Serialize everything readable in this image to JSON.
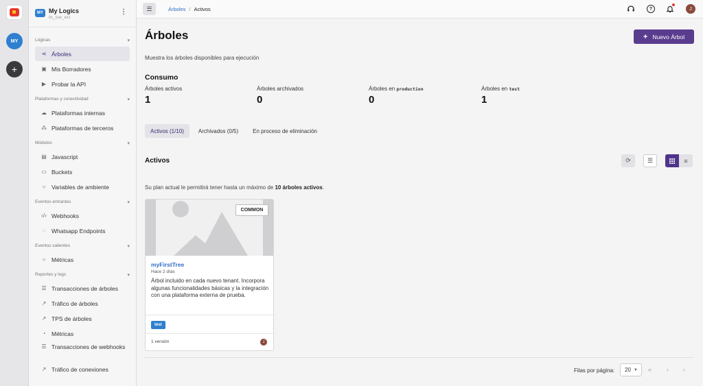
{
  "app": {
    "tenant_badge": "MY",
    "tenant_name": "My Logics",
    "tenant_id": "lts_soe_exz",
    "rail_avatar": "MY",
    "rail_add": "+"
  },
  "sidebar": {
    "sections": [
      {
        "label": "Lógicas",
        "items": [
          {
            "label": "Árboles",
            "icon": "share-icon",
            "active": true
          },
          {
            "label": "Mis Borradores",
            "icon": "image-icon"
          },
          {
            "label": "Probar la API",
            "icon": "play-icon"
          }
        ]
      },
      {
        "label": "Plataformas y conectividad",
        "items": [
          {
            "label": "Plataformas internas",
            "icon": "cloud-icon"
          },
          {
            "label": "Plataformas de terceros",
            "icon": "network-icon"
          }
        ]
      },
      {
        "label": "Módulos",
        "items": [
          {
            "label": "Javascript",
            "icon": "file-icon"
          },
          {
            "label": "Buckets",
            "icon": "bucket-icon"
          },
          {
            "label": "Variables de ambiente",
            "icon": "circle-icon"
          }
        ]
      },
      {
        "label": "Eventos entrantes",
        "items": [
          {
            "label": "Webhooks",
            "icon": "code-icon"
          },
          {
            "label": "Whatsapp Endpoints",
            "icon": "whatsapp-icon"
          }
        ]
      },
      {
        "label": "Eventos salientes",
        "items": [
          {
            "label": "Métricas",
            "icon": "circle-icon"
          }
        ]
      },
      {
        "label": "Reportes y logs",
        "items": [
          {
            "label": "Transacciones de árboles",
            "icon": "list-icon"
          },
          {
            "label": "Tráfico de árboles",
            "icon": "chart-icon"
          },
          {
            "label": "TPS de árboles",
            "icon": "chart-icon"
          },
          {
            "label": "Métricas",
            "icon": "gauge-icon"
          },
          {
            "label": "Transacciones de webhooks",
            "icon": "list-icon"
          },
          {
            "label": "Tráfico de conexiones",
            "icon": "chart-icon"
          }
        ]
      }
    ]
  },
  "topbar": {
    "breadcrumb_parent": "Árboles",
    "breadcrumb_sep": "/",
    "breadcrumb_current": "Activos",
    "user_initial": "J"
  },
  "page": {
    "title": "Árboles",
    "new_button": "Nuevo Árbol",
    "description": "Muestra los árboles disponibles para ejecución",
    "consumption_title": "Consumo",
    "stats": [
      {
        "label": "Árboles activos",
        "code": "",
        "value": "1"
      },
      {
        "label": "Árboles archivados",
        "code": "",
        "value": "0"
      },
      {
        "label": "Árboles en ",
        "code": "production",
        "value": "0"
      },
      {
        "label": "Árboles en ",
        "code": "test",
        "value": "1"
      }
    ],
    "tabs": [
      {
        "label": "Activos (1/10)",
        "active": true
      },
      {
        "label": "Archivados (0/5)"
      },
      {
        "label": "En proceso de eliminación"
      }
    ],
    "section_title": "Activos",
    "plan_prefix": "Su plan actual le permitirá tener hasta un máximo de ",
    "plan_bold": "10 árboles activos",
    "plan_suffix": "."
  },
  "card": {
    "badge": "COMMON",
    "title": "myFirstTree",
    "date": "Hace 2 días",
    "description": "Árbol incluido en cada nuevo tenant. Incorpora algunas funcionalidades básicas y la integración con una plataforma externa de prueba.",
    "tag": "test",
    "version": "1 versión",
    "owner_initial": "J"
  },
  "pagination": {
    "rows_label": "Filas por página:",
    "rows_value": "20",
    "first": "«",
    "prev": "‹",
    "next": "›"
  },
  "colors": {
    "accent": "#5a3c8e",
    "link": "#2f6fc4",
    "badge_blue": "#2f7fd0"
  }
}
